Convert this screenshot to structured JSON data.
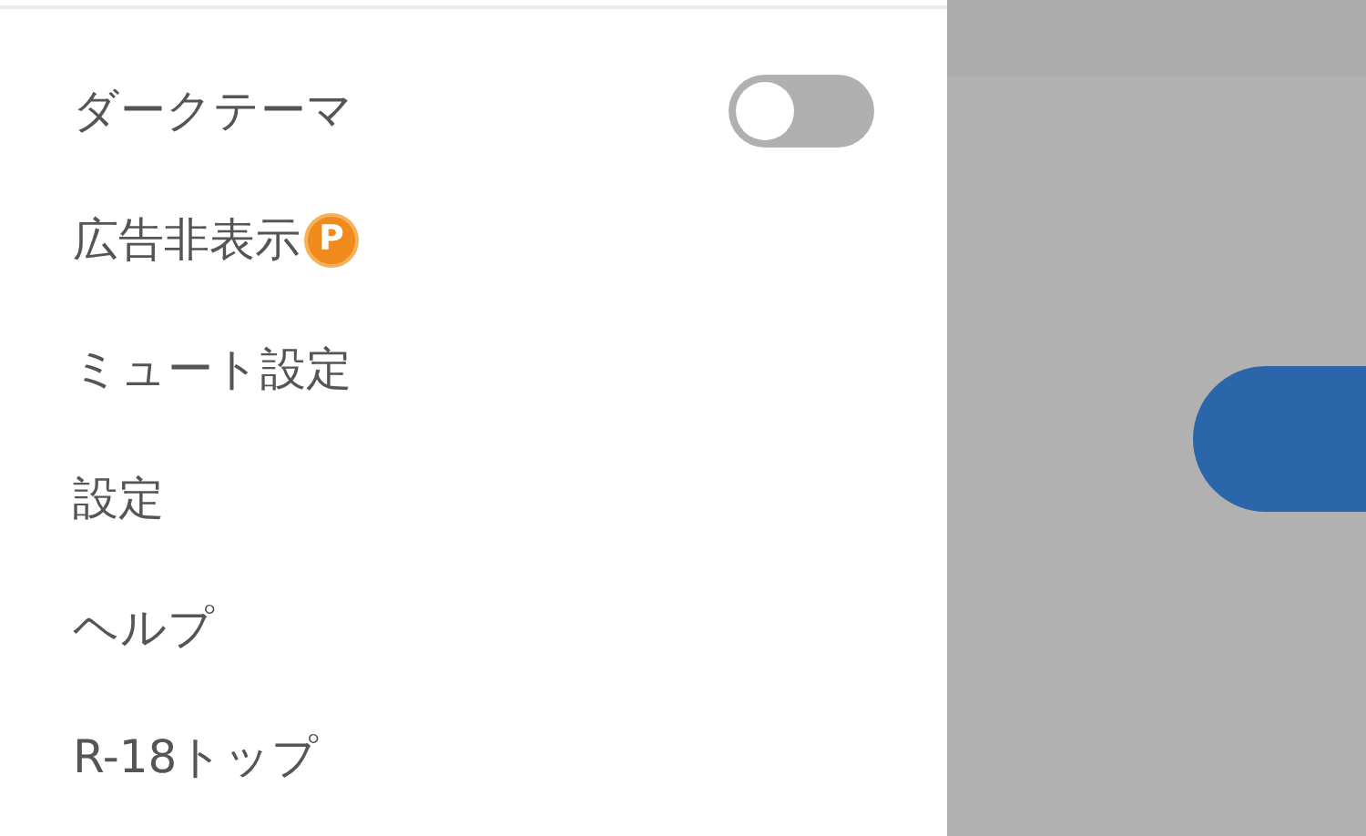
{
  "menu": {
    "items": [
      {
        "kind": "toggle",
        "label": "ダークテーマ",
        "on": false
      },
      {
        "kind": "badge",
        "label": "広告非表示",
        "badge": "P"
      },
      {
        "kind": "link",
        "label": "ミュート設定"
      },
      {
        "kind": "link",
        "label": "設定"
      },
      {
        "kind": "link",
        "label": "ヘルプ"
      },
      {
        "kind": "link",
        "label": "R-18トップ"
      }
    ]
  }
}
